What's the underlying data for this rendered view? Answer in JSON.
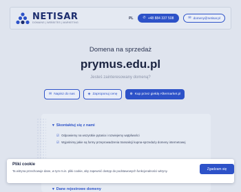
{
  "header": {
    "brand_name": "NETISAR",
    "brand_tagline": "DOMAINS | WEBSITES | MARKETING",
    "lang": "PL",
    "phone_label": "+48 884 337 508",
    "email_label": "domeny@netisar.pl"
  },
  "main": {
    "subtitle": "Domena na sprzedaż",
    "domain": "prymus.edu.pl",
    "question": "Jesteś zainteresowany domeną?",
    "actions": {
      "write_label": "Napisz do nas",
      "propose_label": "Zaproponuj cenę",
      "buy_label": "Kup przez giełdę Aftermarket.pl"
    }
  },
  "card": {
    "section_title": "Skontaktuj się z nami",
    "bullets": [
      "Odpowiemy na wszystkie pytania i rozwiejemy wątpliwości",
      "Wyjaśnimy jakie są formy przeprowadzenia transakcji kupna-sprzedaży domeny internetowej"
    ],
    "section2_title": "Dane rejestrowe domeny"
  },
  "cookie": {
    "title": "Pliki cookie",
    "text": "Ta witryna przechowuje dane, w tym m.in. pliki cookie, aby zapewnić dostęp do podstawowych funkcjonalności witryny.",
    "accept_label": "Zgadzam się"
  },
  "colors": {
    "accent": "#2d52c8",
    "background": "#dfe4ee",
    "brand": "#1c2d6e"
  },
  "icons": {
    "phone": "phone-icon",
    "mail": "mail-icon",
    "chat": "chat-icon",
    "price": "price-tag-icon",
    "cart": "cart-icon",
    "chevron": "chevron-down-icon",
    "check": "check-icon"
  }
}
